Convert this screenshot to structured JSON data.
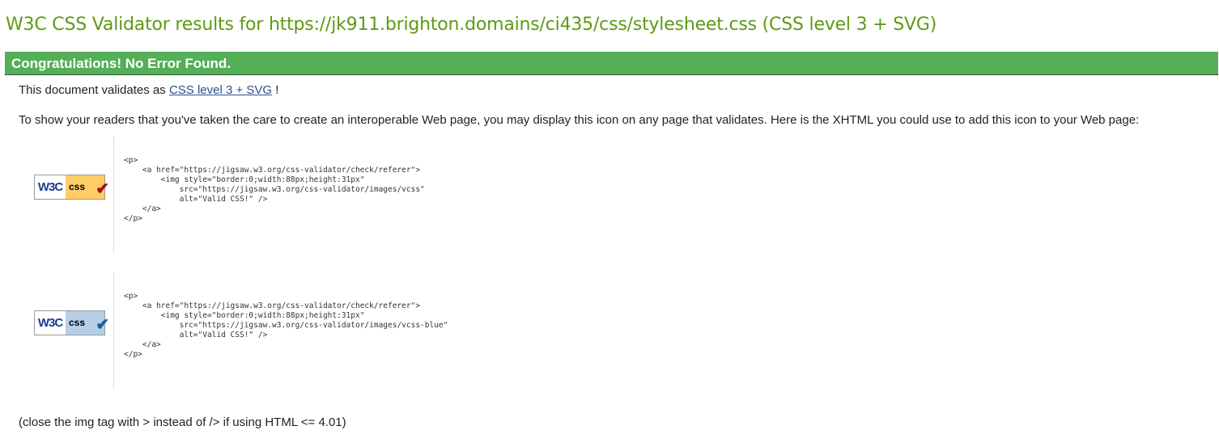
{
  "title": "W3C CSS Validator results for https://jk911.brighton.domains/ci435/css/stylesheet.css (CSS level 3 + SVG)",
  "banner": "Congratulations! No Error Found.",
  "validates": {
    "prefix": "This document validates as",
    "link": "CSS level 3 + SVG",
    "suffix": "!"
  },
  "intro": "To show your readers that you've taken the care to create an interoperable Web page, you may display this icon on any page that validates. Here is the XHTML you could use to add this icon to your Web page:",
  "badges": [
    {
      "w3c": "W3C",
      "css": "css",
      "check": "✔",
      "code": "<p>\n    <a href=\"https://jigsaw.w3.org/css-validator/check/referer\">\n        <img style=\"border:0;width:88px;height:31px\"\n            src=\"https://jigsaw.w3.org/css-validator/images/vcss\"\n            alt=\"Valid CSS!\" />\n    </a>\n</p>"
    },
    {
      "w3c": "W3C",
      "css": "css",
      "check": "✔",
      "code": "<p>\n    <a href=\"https://jigsaw.w3.org/css-validator/check/referer\">\n        <img style=\"border:0;width:88px;height:31px\"\n            src=\"https://jigsaw.w3.org/css-validator/images/vcss-blue\"\n            alt=\"Valid CSS!\" />\n    </a>\n</p>"
    }
  ],
  "footnote": "(close the img tag with > instead of /> if using HTML <= 4.01)",
  "colors": {
    "title": "#5e9a14",
    "banner": "#55ae58",
    "badge1": "#ffcc66",
    "badge2": "#b5cfe6"
  }
}
